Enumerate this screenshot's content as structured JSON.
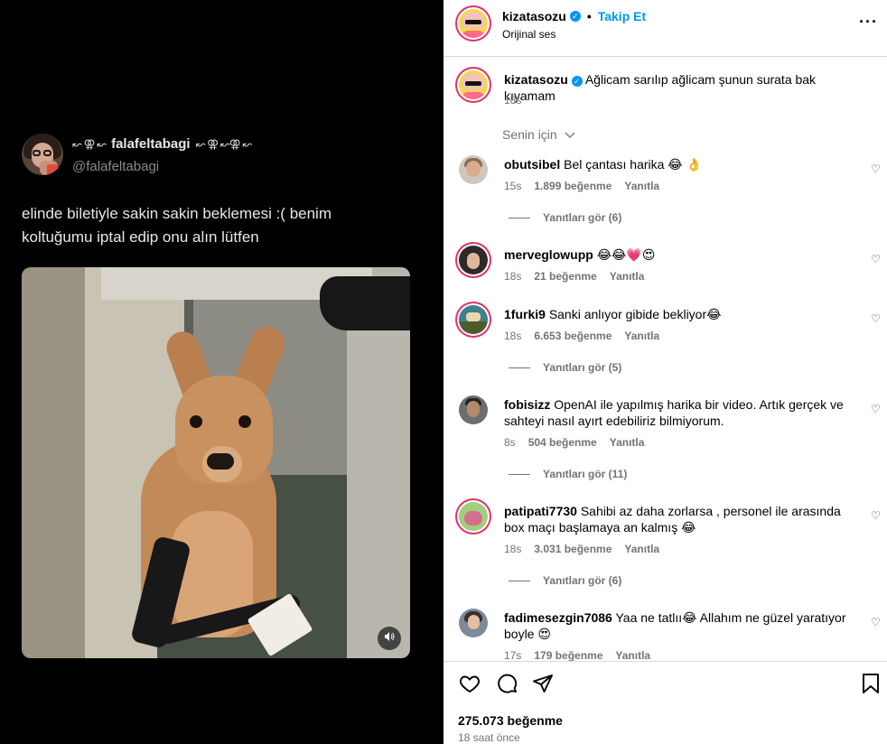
{
  "tweet": {
    "display_name": "falafeltabagi",
    "name_decor_left": "↜ ⚢ ↜",
    "name_decor_right": "↜ ⚢ ↜⚢ ↜",
    "handle": "@falafeltabagi",
    "text": "elinde biletiyle sakin sakin beklemesi :( benim koltuğumu iptal edip onu alın lütfen"
  },
  "post": {
    "username": "kizatasozu",
    "follow_label": "Takip Et",
    "audio": "Orijinal ses",
    "caption": "Ağlicam sarılıp ağlicam şunun surata bak kıyamam",
    "caption_time": "18s",
    "sort_label": "Senin için"
  },
  "comments": [
    {
      "user": "obutsibel",
      "text": "Bel çantası harika 😂 👌",
      "time": "15s",
      "likes": "1.899 beğenme",
      "reply": "Yanıtla",
      "replies": "Yanıtları gör (6)"
    },
    {
      "user": "merveglowupp",
      "text": "😂😂💗😍",
      "time": "18s",
      "likes": "21 beğenme",
      "reply": "Yanıtla"
    },
    {
      "user": "1furki9",
      "text": "Sanki anlıyor gibide bekliyor😂",
      "time": "18s",
      "likes": "6.653 beğenme",
      "reply": "Yanıtla",
      "replies": "Yanıtları gör (5)"
    },
    {
      "user": "fobisizz",
      "text": "OpenAI ile yapılmış harika bir video. Artık gerçek ve sahteyi nasıl ayırt edebiliriz bilmiyorum.",
      "time": "8s",
      "likes": "504 beğenme",
      "reply": "Yanıtla",
      "replies": "Yanıtları gör (11)"
    },
    {
      "user": "patipati7730",
      "text": "Sahibi az daha zorlarsa , personel ile arasında box maçı başlamaya an kalmış 😂",
      "time": "18s",
      "likes": "3.031 beğenme",
      "reply": "Yanıtla",
      "replies": "Yanıtları gör (6)"
    },
    {
      "user": "fadimesezgin7086",
      "text": "Yaa ne tatlıı😂 Allahım ne güzel yaratıyor boyle 😍",
      "time": "17s",
      "likes": "179 beğenme",
      "reply": "Yanıtla"
    }
  ],
  "footer": {
    "likes_total": "275.073 beğenme",
    "time_ago": "18 saat önce"
  },
  "colors": {
    "accent": "#0095f6",
    "muted": "#737373",
    "border": "#dbdbdb"
  },
  "icons": [
    "verified-badge-icon",
    "more-options-icon",
    "chevron-down-icon",
    "heart-icon",
    "comment-icon",
    "share-icon",
    "bookmark-icon",
    "volume-icon"
  ]
}
